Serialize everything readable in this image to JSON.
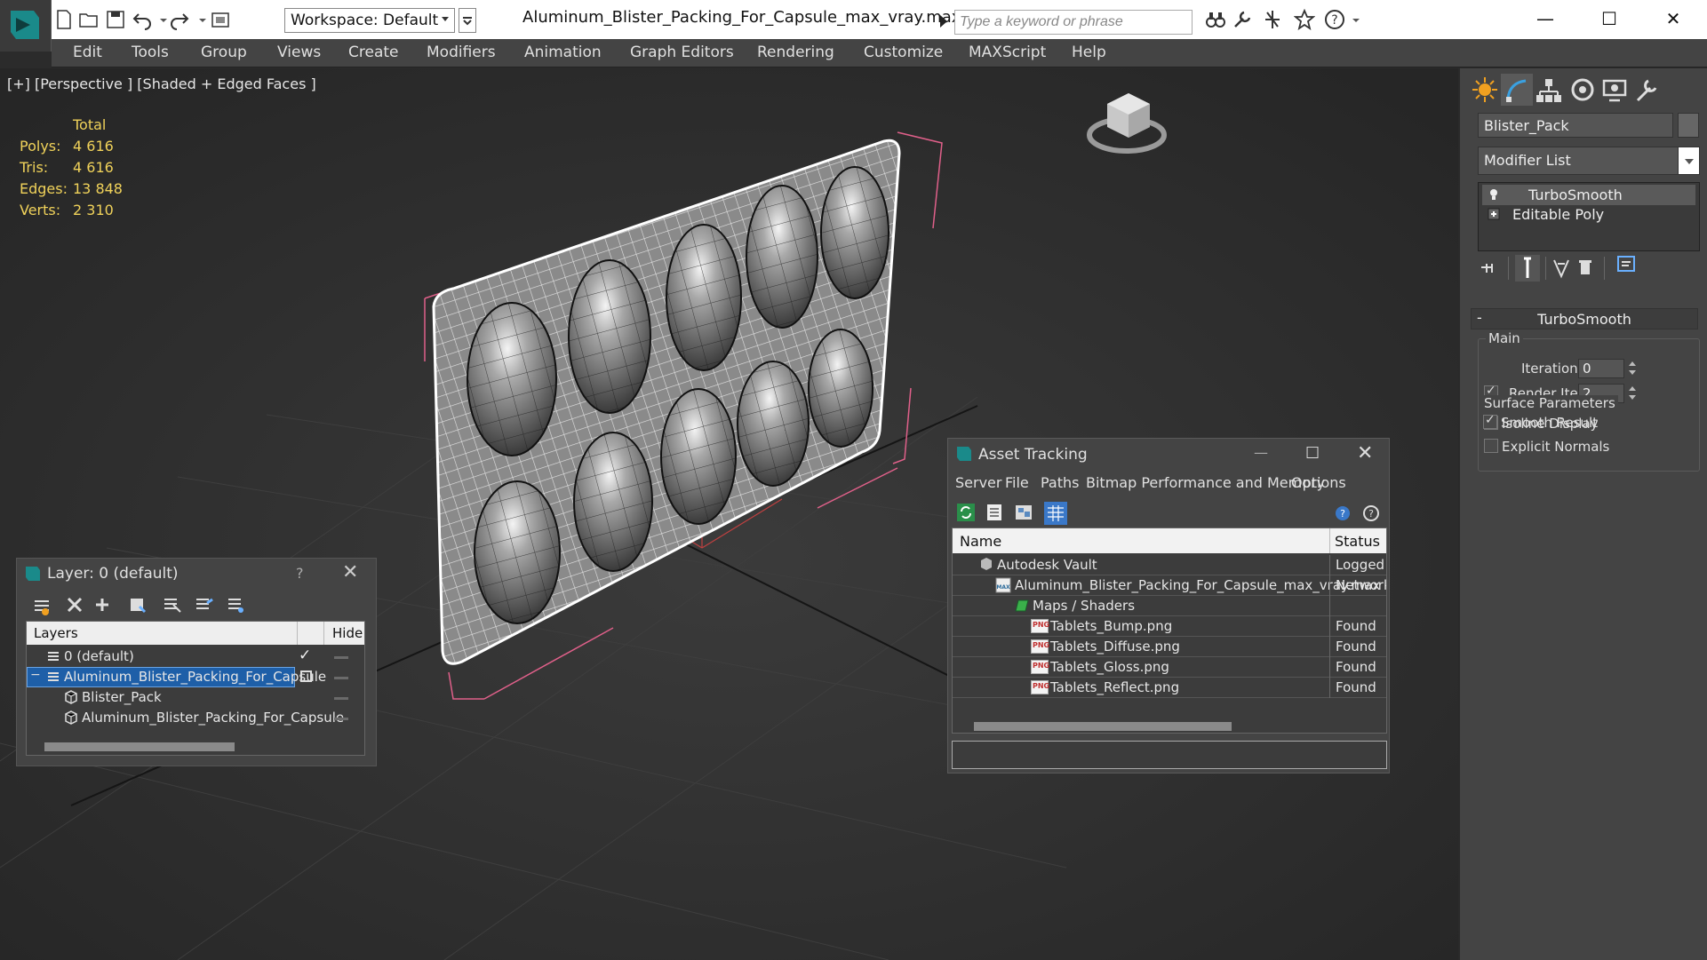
{
  "titlebar": {
    "workspace_label": "Workspace: Default",
    "doc_title": "Aluminum_Blister_Packing_For_Capsule_max_vray.max",
    "search_placeholder": "Type a keyword or phrase",
    "minimize": "—",
    "maximize": "☐",
    "close": "✕"
  },
  "menubar": {
    "items": [
      "Edit",
      "Tools",
      "Group",
      "Views",
      "Create",
      "Modifiers",
      "Animation",
      "Graph Editors",
      "Rendering",
      "Customize",
      "MAXScript",
      "Help"
    ]
  },
  "viewport": {
    "label": "[+] [Perspective ] [Shaded + Edged Faces ]",
    "stats": {
      "header": "Total",
      "rows": [
        {
          "key": "Polys:",
          "value": "4 616"
        },
        {
          "key": "Tris:",
          "value": "4 616"
        },
        {
          "key": "Edges:",
          "value": "13 848"
        },
        {
          "key": "Verts:",
          "value": "2 310"
        }
      ]
    }
  },
  "command_panel": {
    "object_name": "Blister_Pack",
    "modifier_list": "Modifier List",
    "stack": [
      "TurboSmooth",
      "Editable Poly"
    ],
    "rollout_title": "TurboSmooth",
    "rollout_toggle": "-",
    "main_group": "Main",
    "iterations_label": "Iterations:",
    "iterations_value": "0",
    "render_iters_label": "Render Iters:",
    "render_iters_value": "2",
    "render_iters_checked": true,
    "isoline_label": "Isoline Display",
    "isoline_checked": false,
    "explicit_normals_label": "Explicit Normals",
    "explicit_normals_checked": false,
    "surface_group": "Surface Parameters",
    "smooth_result_label": "Smooth Result",
    "smooth_result_checked": true
  },
  "layer_panel": {
    "title": "Layer: 0 (default)",
    "help": "?",
    "close": "✕",
    "col_layers": "Layers",
    "col_hide": "Hide",
    "rows": [
      {
        "label": "0 (default)",
        "indent": 0,
        "selected": false,
        "current": true
      },
      {
        "label": "Aluminum_Blister_Packing_For_Capsule",
        "indent": 0,
        "selected": true,
        "current": false
      },
      {
        "label": "Blister_Pack",
        "indent": 1,
        "selected": false,
        "current": false
      },
      {
        "label": "Aluminum_Blister_Packing_For_Capsule",
        "indent": 1,
        "selected": false,
        "current": false
      }
    ],
    "tree_toggle": "−",
    "current_mark": "✓"
  },
  "asset_panel": {
    "title": "Asset Tracking",
    "minimize": "—",
    "maximize": "☐",
    "close": "✕",
    "menu": [
      "Server",
      "File",
      "Paths",
      "Bitmap Performance and Memory",
      "Options"
    ],
    "col_name": "Name",
    "col_status": "Status",
    "rows": [
      {
        "label": "Autodesk Vault",
        "status": "Logged O",
        "indent": 1,
        "icon": "vault-icon"
      },
      {
        "label": "Aluminum_Blister_Packing_For_Capsule_max_vray.max",
        "status": "Network",
        "indent": 2,
        "icon": "max-file-icon"
      },
      {
        "label": "Maps / Shaders",
        "status": "",
        "indent": 3,
        "icon": "maps-icon"
      },
      {
        "label": "Tablets_Bump.png",
        "status": "Found",
        "indent": 4,
        "icon": "png-icon"
      },
      {
        "label": "Tablets_Diffuse.png",
        "status": "Found",
        "indent": 4,
        "icon": "png-icon"
      },
      {
        "label": "Tablets_Gloss.png",
        "status": "Found",
        "indent": 4,
        "icon": "png-icon"
      },
      {
        "label": "Tablets_Reflect.png",
        "status": "Found",
        "indent": 4,
        "icon": "png-icon"
      }
    ]
  },
  "colors": {
    "accent": "#1e5fa8",
    "stats_text": "#f0d25a",
    "selection_bracket": "#e0608a"
  }
}
